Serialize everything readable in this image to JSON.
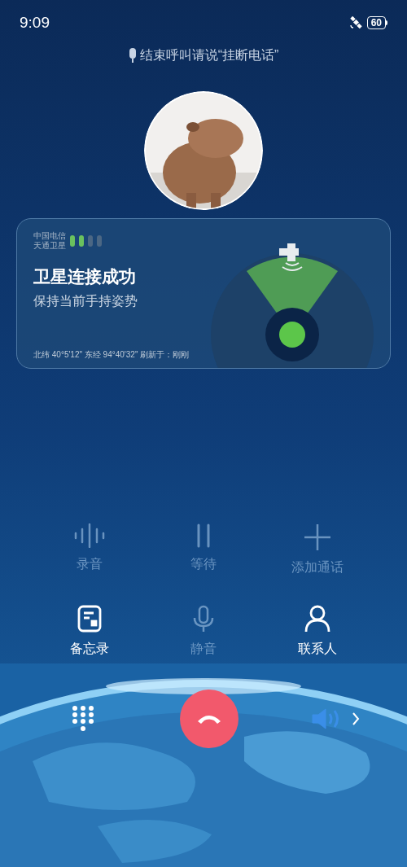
{
  "status_bar": {
    "time": "9:09",
    "battery": "60"
  },
  "voice_hint": "结束呼叫请说“挂断电话”",
  "satellite_card": {
    "carrier": "中国电信",
    "network": "天通卫星",
    "title": "卫星连接成功",
    "subtitle": "保持当前手持姿势",
    "location": "北纬 40°5'12\" 东经 94°40'32\" 刷新于：刚刚"
  },
  "actions": [
    {
      "kind": "record",
      "label": "录音",
      "disabled": true
    },
    {
      "kind": "hold",
      "label": "等待",
      "disabled": true
    },
    {
      "kind": "add",
      "label": "添加通话",
      "disabled": true
    },
    {
      "kind": "memo",
      "label": "备忘录",
      "disabled": false
    },
    {
      "kind": "mute",
      "label": "静音",
      "disabled": true
    },
    {
      "kind": "contacts",
      "label": "联系人",
      "disabled": false
    }
  ],
  "speaker": {
    "on": true
  }
}
